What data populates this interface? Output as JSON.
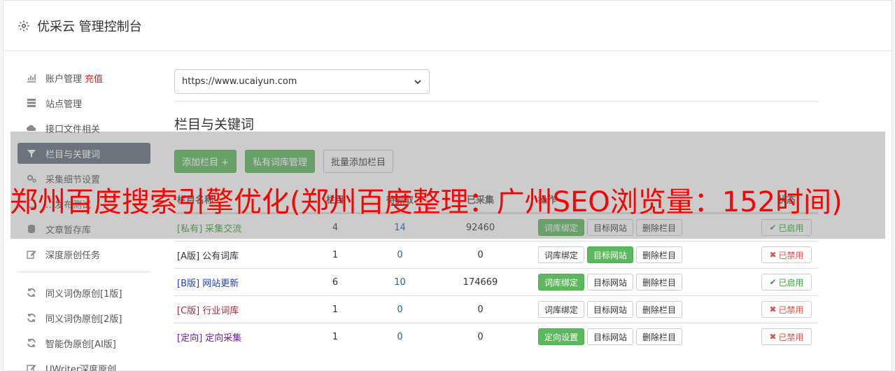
{
  "header": {
    "title": "优采云 管理控制台"
  },
  "sidebar": {
    "items": [
      {
        "icon": "bar-chart-icon",
        "label": "账户管理",
        "extra": "充值"
      },
      {
        "icon": "server-icon",
        "label": "站点管理"
      },
      {
        "icon": "cloud-upload-icon",
        "label": "接口文件相关"
      },
      {
        "icon": "filter-icon",
        "label": "栏目与关键词",
        "active": true
      },
      {
        "icon": "cogs-icon",
        "label": "采集细节设置"
      },
      {
        "icon": "test-icon",
        "label": "…发布测试"
      },
      {
        "icon": "database-icon",
        "label": "文章暂存库"
      },
      {
        "icon": "edit-icon",
        "label": "深度原创任务"
      }
    ],
    "items2": [
      {
        "icon": "refresh-icon",
        "label": "同义词伪原创[1版]"
      },
      {
        "icon": "refresh-icon",
        "label": "同义词伪原创[2版]"
      },
      {
        "icon": "refresh-icon",
        "label": "智能伪原创[AI版]"
      },
      {
        "icon": "edit-icon",
        "label": "UWriter深度原创"
      }
    ]
  },
  "main": {
    "site_select": "https://www.ucaiyun.com",
    "section_title": "栏目与关键词",
    "buttons": {
      "add": "添加栏目 +",
      "private_lib": "私有词库管理",
      "batch_add": "批量添加栏目"
    },
    "table": {
      "headers": {
        "name": "栏目名称",
        "a": "栏目",
        "b": "待抓取",
        "c": "已采集",
        "ops": "操作",
        "status": "状态"
      },
      "rows": [
        {
          "name": "[私有] 采集交流",
          "name_color": "#3c9a3c",
          "a": "4",
          "b": "14",
          "c": "92460",
          "op1": "词库绑定",
          "op1_green": true,
          "op2": "目标网站",
          "op2_green": false,
          "op3": "删除栏目",
          "status": "已启用",
          "enabled": true
        },
        {
          "name": "[A版] 公有词库",
          "name_color": "#333333",
          "a": "1",
          "b": "0",
          "c": "0",
          "op1": "词库绑定",
          "op1_green": false,
          "op2": "目标网站",
          "op2_green": true,
          "op3": "删除栏目",
          "status": "已禁用",
          "enabled": false
        },
        {
          "name": "[B版] 网站更新",
          "name_color": "#2040c0",
          "a": "6",
          "b": "10",
          "c": "174669",
          "op1": "词库绑定",
          "op1_green": true,
          "op2": "目标网站",
          "op2_green": false,
          "op3": "删除栏目",
          "status": "已启用",
          "enabled": true
        },
        {
          "name": "[C版] 行业词库",
          "name_color": "#a0303a",
          "a": "1",
          "b": "0",
          "c": "0",
          "op1": "词库绑定",
          "op1_green": false,
          "op2": "目标网站",
          "op2_green": false,
          "op3": "删除栏目",
          "status": "已禁用",
          "enabled": false
        },
        {
          "name": "[定向] 定向采集",
          "name_color": "#6a1fb0",
          "a": "1",
          "b": "0",
          "c": "0",
          "op1": "定向设置",
          "op1_green": true,
          "op2": "目标网站",
          "op2_green": false,
          "op3": "删除栏目",
          "status": "已禁用",
          "enabled": false
        }
      ]
    }
  },
  "overlay": {
    "text": "郑州百度搜索引擎优化(郑州百度整理：广州SEO浏览量：152时间)"
  }
}
